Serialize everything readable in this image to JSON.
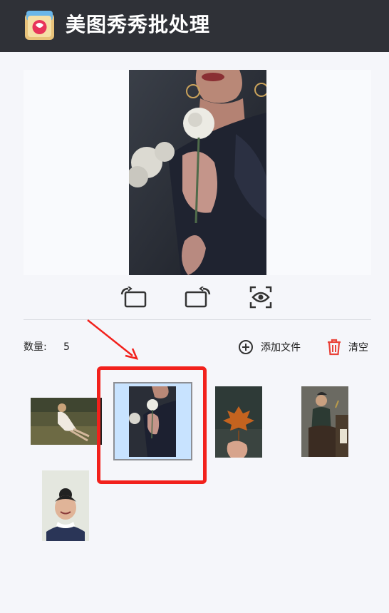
{
  "app": {
    "title": "美图秀秀批处理",
    "logo_icon": "meitu-xiuxiu-logo"
  },
  "toolbar": {
    "rotate_left_icon": "rotate-left-icon",
    "rotate_right_icon": "rotate-right-icon",
    "preview_icon": "eye-icon"
  },
  "files": {
    "count_label": "数量:",
    "count_value": "5",
    "add_label": "添加文件",
    "clear_label": "清空"
  },
  "thumbnails": [
    {
      "name": "thumb-woman-lying-grass"
    },
    {
      "name": "thumb-woman-rose",
      "selected": true
    },
    {
      "name": "thumb-hand-maple-leaf"
    },
    {
      "name": "thumb-woman-qipao"
    },
    {
      "name": "thumb-girl-smiling"
    }
  ],
  "colors": {
    "header_bg": "#2f3137",
    "accent_red": "#f2211c",
    "selection_bg": "#c8e3ff"
  }
}
